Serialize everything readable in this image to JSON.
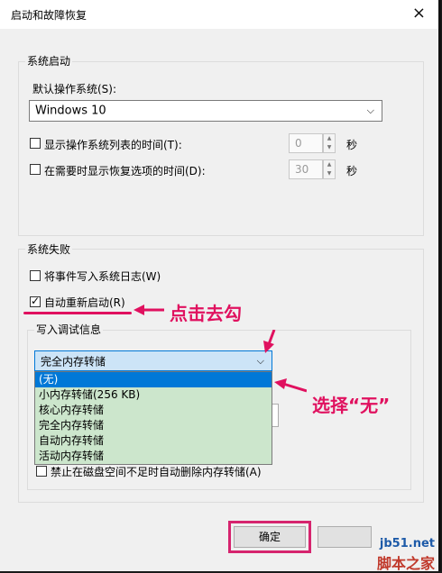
{
  "window": {
    "title": "启动和故障恢复",
    "close_icon": "×"
  },
  "system_startup": {
    "group_label": "系统启动",
    "default_os_label": "默认操作系统(S):",
    "default_os_value": "Windows 10",
    "show_os_list_label": "显示操作系统列表的时间(T):",
    "show_os_list_value": "0",
    "show_recovery_label": "在需要时显示恢复选项的时间(D):",
    "show_recovery_value": "30",
    "seconds_unit": "秒"
  },
  "system_failure": {
    "group_label": "系统失败",
    "write_event_label": "将事件写入系统日志(W)",
    "auto_restart_label": "自动重新启动(R)",
    "debug_info_label": "写入调试信息",
    "debug_select_value": "完全内存转储",
    "dropdown_options": [
      "(无)",
      "小内存转储(256 KB)",
      "核心内存转储",
      "完全内存转储",
      "自动内存转储",
      "活动内存转储"
    ],
    "disable_delete_label": "禁止在磁盘空间不足时自动删除内存转储(A)"
  },
  "buttons": {
    "ok_label": "确定"
  },
  "annotations": {
    "uncheck_text": "点击去勾",
    "select_none_text": "选择“无”"
  },
  "watermark": {
    "site": "jb51.net",
    "name": "脚本之家"
  },
  "colors": {
    "annotation": "#e0115f",
    "dropdown_bg": "#cce6cc",
    "selected": "#0078d7"
  }
}
